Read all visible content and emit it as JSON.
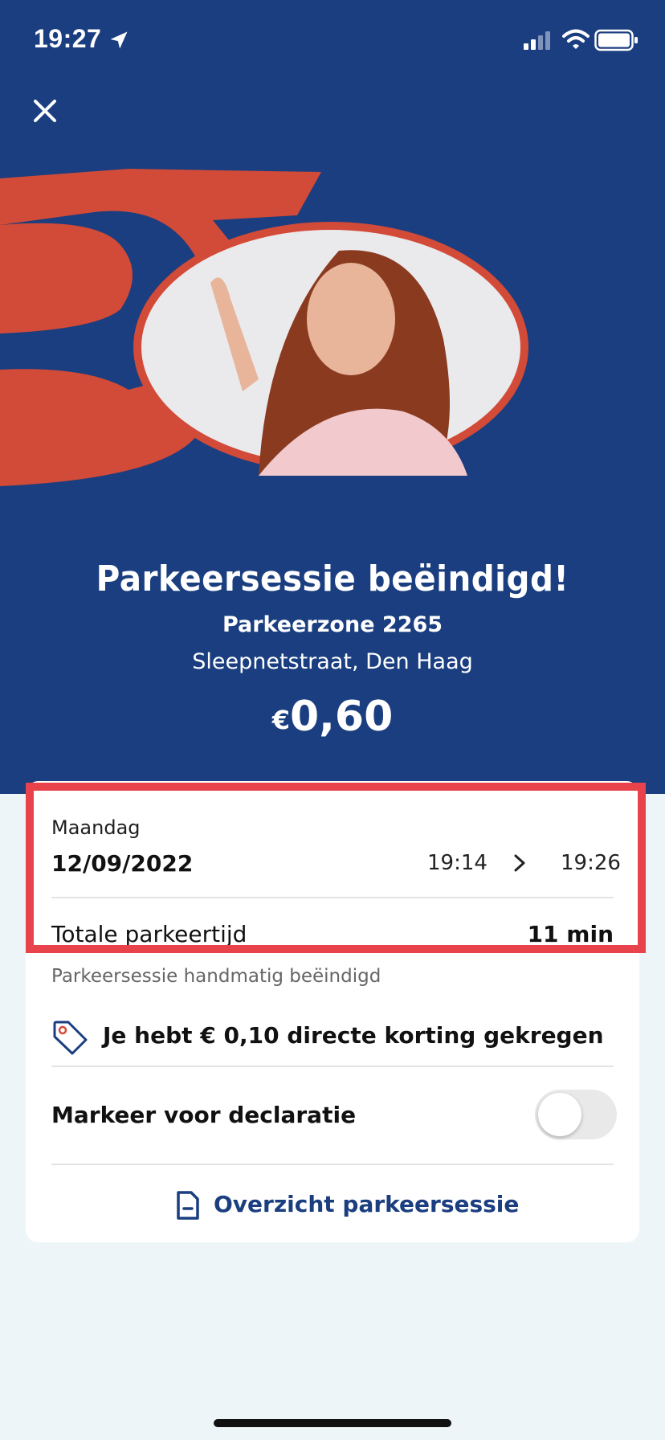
{
  "status_bar": {
    "time": "19:27"
  },
  "hero": {
    "title": "Parkeersessie beëindigd!",
    "zone": "Parkeerzone 2265",
    "address": "Sleepnetstraat, Den Haag",
    "currency": "€",
    "amount": "0,60"
  },
  "session": {
    "day": "Maandag",
    "date": "12/09/2022",
    "start_time": "19:14",
    "end_time": "19:26",
    "total_label": "Totale parkeertijd",
    "total_value": "11 min",
    "ended_note": "Parkeersessie handmatig beëindigd"
  },
  "discount": {
    "text": "Je hebt € 0,10 directe korting gekregen"
  },
  "declaration": {
    "label": "Markeer voor declaratie",
    "enabled": false
  },
  "overview": {
    "label": "Overzicht parkeersessie"
  },
  "colors": {
    "brand_blue": "#1a3e7f",
    "brand_red": "#d24a38",
    "highlight": "#e8434b",
    "background": "#eef5f9"
  },
  "icons": [
    "location-arrow-icon",
    "signal-icon",
    "wifi-icon",
    "battery-icon",
    "close-icon",
    "chevron-right-icon",
    "tag-icon",
    "document-icon"
  ]
}
